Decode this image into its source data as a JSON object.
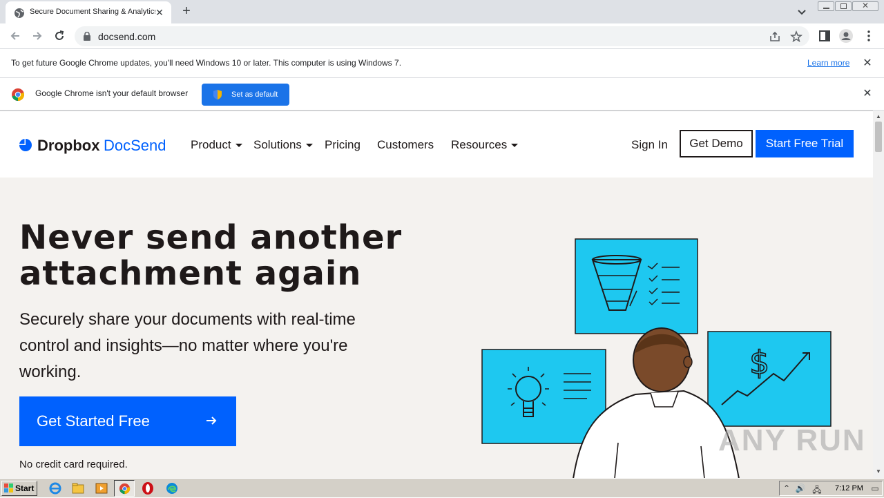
{
  "browser": {
    "tab_title": "Secure Document Sharing & Analytics",
    "url": "docsend.com",
    "update_bar": {
      "message": "To get future Google Chrome updates, you'll need Windows 10 or later. This computer is using Windows 7.",
      "link": "Learn more"
    },
    "default_bar": {
      "message": "Google Chrome isn't your default browser",
      "button": "Set as default"
    }
  },
  "site": {
    "brand_primary": "Dropbox",
    "brand_secondary": "DocSend",
    "nav": [
      {
        "label": "Product",
        "dropdown": true
      },
      {
        "label": "Solutions",
        "dropdown": true
      },
      {
        "label": "Pricing",
        "dropdown": false
      },
      {
        "label": "Customers",
        "dropdown": false
      },
      {
        "label": "Resources",
        "dropdown": true
      }
    ],
    "sign_in": "Sign In",
    "get_demo": "Get Demo",
    "start_trial": "Start Free Trial",
    "headline_line1": "Never send another",
    "headline_line2": "attachment again",
    "subheadline": "Securely share your documents with real-time control and insights—no matter where you're working.",
    "cta": "Get Started Free",
    "cta_note": "No credit card required.",
    "colors": {
      "brand_blue": "#0061fe",
      "hero_bg": "#f4f2ef",
      "illustration_panel": "#1ec8f0",
      "text": "#1e1919"
    }
  },
  "watermark": "ANY RUN",
  "taskbar": {
    "start_label": "Start",
    "clock": "7:12 PM"
  }
}
